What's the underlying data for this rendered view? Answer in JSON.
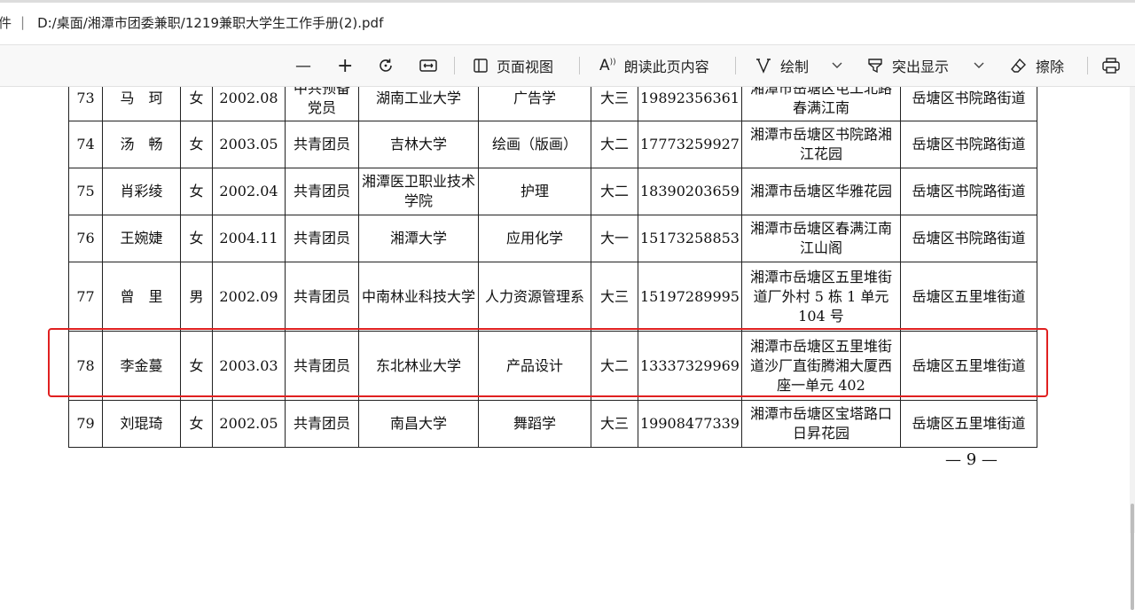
{
  "address": {
    "file_label": "件",
    "separator": "|",
    "path": "D:/桌面/湘潭市团委兼职/1219兼职大学生工作手册(2).pdf"
  },
  "toolbar": {
    "zoom_out_label": "—",
    "zoom_in_label": "+",
    "page_view_label": "页面视图",
    "read_aloud_label": "朗读此页内容",
    "draw_label": "绘制",
    "highlight_label": "突出显示",
    "erase_label": "擦除"
  },
  "table": {
    "rows": [
      {
        "no": "73",
        "name": "马　珂",
        "gender": "女",
        "birth": "2002.08",
        "politics": "中共预备党员",
        "school": "湖南工业大学",
        "major": "广告学",
        "grade": "大三",
        "phone": "19892356361",
        "address": "湘潭市岳塘区屯工北路春满江南",
        "district": "岳塘区书院路街道"
      },
      {
        "no": "74",
        "name": "汤　畅",
        "gender": "女",
        "birth": "2003.05",
        "politics": "共青团员",
        "school": "吉林大学",
        "major": "绘画（版画）",
        "grade": "大二",
        "phone": "17773259927",
        "address": "湘潭市岳塘区书院路湘江花园",
        "district": "岳塘区书院路街道"
      },
      {
        "no": "75",
        "name": "肖彩绫",
        "gender": "女",
        "birth": "2002.04",
        "politics": "共青团员",
        "school": "湘潭医卫职业技术学院",
        "major": "护理",
        "grade": "大二",
        "phone": "18390203659",
        "address": "湘潭市岳塘区华雅花园",
        "district": "岳塘区书院路街道"
      },
      {
        "no": "76",
        "name": "王婉婕",
        "gender": "女",
        "birth": "2004.11",
        "politics": "共青团员",
        "school": "湘潭大学",
        "major": "应用化学",
        "grade": "大一",
        "phone": "15173258853",
        "address": "湘潭市岳塘区春满江南江山阁",
        "district": "岳塘区书院路街道"
      },
      {
        "no": "77",
        "name": "曾　里",
        "gender": "男",
        "birth": "2002.09",
        "politics": "共青团员",
        "school": "中南林业科技大学",
        "major": "人力资源管理系",
        "grade": "大三",
        "phone": "15197289995",
        "address": "湘潭市岳塘区五里堆街道厂外村 5 栋 1 单元 104 号",
        "district": "岳塘区五里堆街道"
      },
      {
        "no": "78",
        "name": "李金蔓",
        "gender": "女",
        "birth": "2003.03",
        "politics": "共青团员",
        "school": "东北林业大学",
        "major": "产品设计",
        "grade": "大二",
        "phone": "13337329969",
        "address": "湘潭市岳塘区五里堆街道沙厂直街腾湘大厦西座一单元 402",
        "district": "岳塘区五里堆街道"
      },
      {
        "no": "79",
        "name": "刘琨琦",
        "gender": "女",
        "birth": "2002.05",
        "politics": "共青团员",
        "school": "南昌大学",
        "major": "舞蹈学",
        "grade": "大三",
        "phone": "19908477339",
        "address": "湘潭市岳塘区宝塔路口日昇花园",
        "district": "岳塘区五里堆街道"
      }
    ]
  },
  "page_number": "— 9 —",
  "colors": {
    "highlight_box": "#e02020",
    "toolbar_bg": "#f8f8f8"
  }
}
